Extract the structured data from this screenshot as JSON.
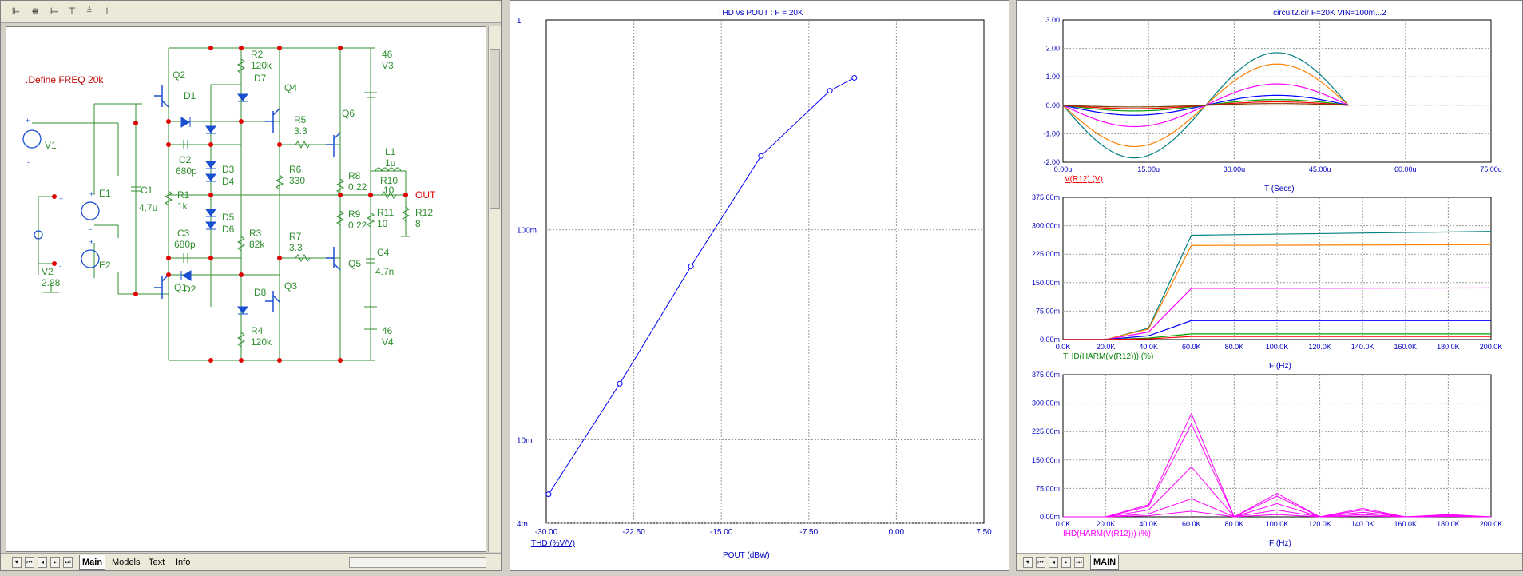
{
  "schematic": {
    "define_label": ".Define FREQ 20k",
    "components": {
      "q2": "Q2",
      "q1": "Q1",
      "q4": "Q4",
      "q3": "Q3",
      "q6": "Q6",
      "q5": "Q5",
      "d1": "D1",
      "d2": "D2",
      "d3": "D3",
      "d4": "D4",
      "d5": "D5",
      "d6": "D6",
      "d7": "D7",
      "d8": "D8",
      "r2": "R2",
      "r2v": "120k",
      "r4": "R4",
      "r4v": "120k",
      "r5": "R5",
      "r5v": "3.3",
      "r6": "R6",
      "r6v": "330",
      "r7": "R7",
      "r7v": "3.3",
      "r3": "R3",
      "r3v": "82k",
      "r1": "R1",
      "r1v": "1k",
      "r8": "R8",
      "r8v": "0.22",
      "r9": "R9",
      "r9v": "0.22",
      "r10": "R10",
      "r10v": "10",
      "r11": "R11",
      "r11v": "10",
      "r12": "R12",
      "r12v": "8",
      "c1": "C1",
      "c1v": "4.7u",
      "c2": "C2",
      "c2v": "680p",
      "c3": "C3",
      "c3v": "680p",
      "c4": "C4",
      "c4v": "4.7n",
      "l1": "L1",
      "l1v": "1u",
      "v1": "V1",
      "v2": "V2",
      "v2v": "2.28",
      "v3": "V3",
      "v3v": "46",
      "v4": "V4",
      "v4v": "46",
      "e1": "E1",
      "e2": "E2",
      "out": "OUT",
      "plus": "+",
      "minus": "-"
    }
  },
  "left_tabs": {
    "main": "Main",
    "models": "Models",
    "text": "Text",
    "info": "Info"
  },
  "right_tabs": {
    "main": "MAIN"
  },
  "thd_chart": {
    "title": "THD vs POUT : F = 20K",
    "xlabel": "POUT (dBW)",
    "ylabel": "THD (%V/V)",
    "x_ticks": [
      "-30.00",
      "-22.50",
      "-15.00",
      "-7.50",
      "0.00",
      "7.50"
    ],
    "y_ticks": [
      "1",
      "100m",
      "10m",
      "4m"
    ]
  },
  "right_charts": {
    "title": "circuit2.cir F=20K VIN=100m...2",
    "top": {
      "y_ticks": [
        "3.00",
        "2.00",
        "1.00",
        "0.00",
        "-1.00",
        "-2.00"
      ],
      "x_ticks": [
        "0.00u",
        "15.00u",
        "30.00u",
        "45.00u",
        "60.00u",
        "75.00u"
      ],
      "ylabel": "V(R12) (V)",
      "xlabel": "T (Secs)"
    },
    "mid": {
      "y_ticks": [
        "375.00m",
        "300.00m",
        "225.00m",
        "150.00m",
        "75.00m",
        "0.00m"
      ],
      "x_ticks": [
        "0.0K",
        "20.0K",
        "40.0K",
        "60.0K",
        "80.0K",
        "100.0K",
        "120.0K",
        "140.0K",
        "160.0K",
        "180.0K",
        "200.0K"
      ],
      "ylabel": "THD(HARM(V(R12))) (%)",
      "xlabel": "F (Hz)"
    },
    "bot": {
      "y_ticks": [
        "375.00m",
        "300.00m",
        "225.00m",
        "150.00m",
        "75.00m",
        "0.00m"
      ],
      "x_ticks": [
        "0.0K",
        "20.0K",
        "40.0K",
        "60.0K",
        "80.0K",
        "100.0K",
        "120.0K",
        "140.0K",
        "160.0K",
        "180.0K",
        "200.0K"
      ],
      "ylabel": "IHD(HARM(V(R12))) (%)",
      "xlabel": "F (Hz)"
    }
  },
  "chart_data": [
    {
      "type": "line",
      "title": "THD vs POUT : F = 20K",
      "xlabel": "POUT (dBW)",
      "ylabel": "THD (%V/V)",
      "xlim": [
        -30.0,
        7.5
      ],
      "ylim": [
        0.004,
        1
      ],
      "yscale": "log",
      "grid": true,
      "series": [
        {
          "x": [
            -29.8,
            -23.7,
            -17.6,
            -11.6,
            -5.7,
            -3.6
          ],
          "y": [
            0.0055,
            0.0185,
            0.067,
            0.225,
            0.46,
            0.53
          ],
          "color": "#0000ff"
        }
      ]
    },
    {
      "type": "line",
      "title": "circuit2.cir F=20K VIN=100m...2",
      "xlabel": "T (Secs)",
      "ylabel": "V(R12) (V)",
      "xlim": [
        0,
        75
      ],
      "ylim": [
        -2,
        3
      ],
      "grid": true,
      "series": [
        {
          "amplitude": 1.85,
          "color": "#008080"
        },
        {
          "amplitude": 1.45,
          "color": "#ff8000"
        },
        {
          "amplitude": 0.75,
          "color": "#ff00ff"
        },
        {
          "amplitude": 0.35,
          "color": "#0000ff"
        },
        {
          "amplitude": 0.2,
          "color": "#00a000"
        },
        {
          "amplitude": 0.12,
          "color": "#ff0000"
        },
        {
          "amplitude": 0.06,
          "color": "#804000"
        }
      ]
    },
    {
      "type": "line",
      "xlabel": "F (Hz)",
      "ylabel": "THD(HARM(V(R12))) (%)",
      "xlim": [
        0,
        200
      ],
      "ylim": [
        0,
        375
      ],
      "grid": true,
      "series": [
        {
          "x": [
            0,
            20,
            40,
            60,
            200
          ],
          "y": [
            0,
            0,
            30,
            275,
            285
          ],
          "color": "#008080"
        },
        {
          "x": [
            0,
            20,
            40,
            60,
            200
          ],
          "y": [
            0,
            0,
            28,
            248,
            250
          ],
          "color": "#ff8000"
        },
        {
          "x": [
            0,
            20,
            40,
            60,
            200
          ],
          "y": [
            0,
            0,
            20,
            135,
            136
          ],
          "color": "#ff00ff"
        },
        {
          "x": [
            0,
            20,
            40,
            60,
            200
          ],
          "y": [
            0,
            0,
            10,
            50,
            50
          ],
          "color": "#0000ff"
        },
        {
          "x": [
            0,
            20,
            40,
            60,
            200
          ],
          "y": [
            0,
            0,
            4,
            15,
            15
          ],
          "color": "#00a000"
        },
        {
          "x": [
            0,
            20,
            40,
            60,
            200
          ],
          "y": [
            0,
            0,
            2,
            8,
            8
          ],
          "color": "#ff0000"
        }
      ]
    },
    {
      "type": "line",
      "xlabel": "F (Hz)",
      "ylabel": "IHD(HARM(V(R12))) (%)",
      "xlim": [
        0,
        200
      ],
      "ylim": [
        0,
        375
      ],
      "grid": true,
      "series": [
        {
          "x": [
            0,
            20,
            40,
            60,
            80,
            100,
            120,
            140,
            160,
            180,
            200
          ],
          "y": [
            0,
            0,
            32,
            272,
            0,
            62,
            0,
            22,
            0,
            6,
            0
          ],
          "color": "#ff00ff"
        },
        {
          "x": [
            0,
            20,
            40,
            60,
            80,
            100,
            120,
            140,
            160,
            180,
            200
          ],
          "y": [
            0,
            0,
            28,
            245,
            0,
            55,
            0,
            18,
            0,
            5,
            0
          ],
          "color": "#ff00ff"
        },
        {
          "x": [
            0,
            20,
            40,
            60,
            80,
            100,
            120,
            140,
            160,
            180,
            200
          ],
          "y": [
            0,
            0,
            18,
            132,
            0,
            35,
            0,
            12,
            0,
            3,
            0
          ],
          "color": "#ff00ff"
        },
        {
          "x": [
            0,
            20,
            40,
            60,
            80,
            100,
            120,
            140,
            160,
            180,
            200
          ],
          "y": [
            0,
            0,
            8,
            48,
            0,
            18,
            0,
            6,
            0,
            2,
            0
          ],
          "color": "#ff00ff"
        },
        {
          "x": [
            0,
            20,
            40,
            60,
            80,
            100,
            120,
            140,
            160,
            180,
            200
          ],
          "y": [
            0,
            0,
            3,
            15,
            0,
            6,
            0,
            2,
            0,
            1,
            0
          ],
          "color": "#ff00ff"
        }
      ]
    }
  ]
}
